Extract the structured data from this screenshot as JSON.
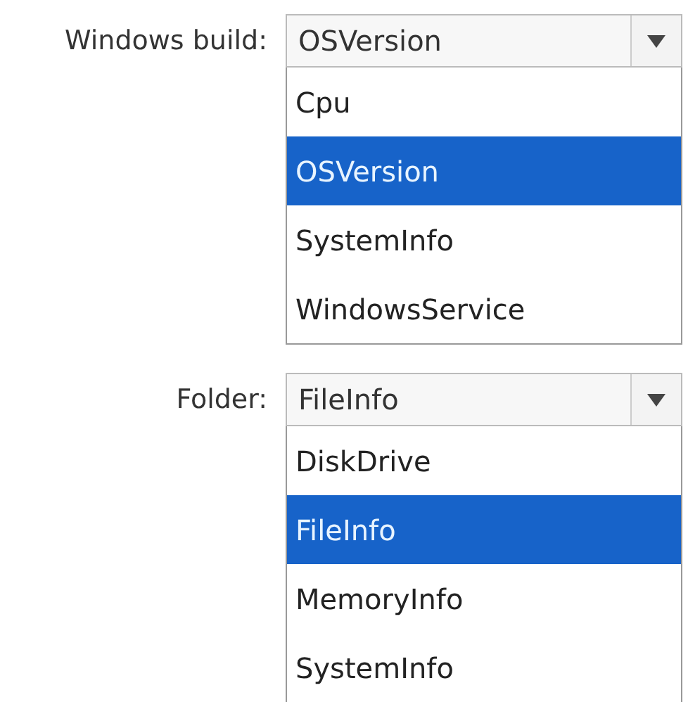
{
  "dropdowns": [
    {
      "label": "Windows build:",
      "value": "OSVersion",
      "expanded": true,
      "options": [
        {
          "label": "Cpu",
          "selected": false
        },
        {
          "label": "OSVersion",
          "selected": true
        },
        {
          "label": "SystemInfo",
          "selected": false
        },
        {
          "label": "WindowsService",
          "selected": false
        }
      ]
    },
    {
      "label": "Folder:",
      "value": "FileInfo",
      "expanded": true,
      "options": [
        {
          "label": "DiskDrive",
          "selected": false
        },
        {
          "label": "FileInfo",
          "selected": true
        },
        {
          "label": "MemoryInfo",
          "selected": false
        },
        {
          "label": "SystemInfo",
          "selected": false
        }
      ]
    }
  ]
}
